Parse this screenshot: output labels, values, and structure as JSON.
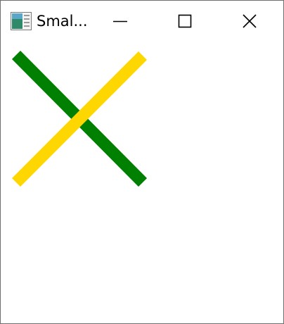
{
  "window": {
    "title": "Smal...",
    "icon": "app-window-icon",
    "controls": {
      "minimize_icon": "minimize-icon",
      "maximize_icon": "maximize-icon",
      "close_icon": "close-icon"
    }
  },
  "content": {
    "shapes": [
      {
        "name": "green-diagonal-line",
        "color": "#008000"
      },
      {
        "name": "gold-diagonal-line",
        "color": "#FFD700"
      }
    ]
  }
}
